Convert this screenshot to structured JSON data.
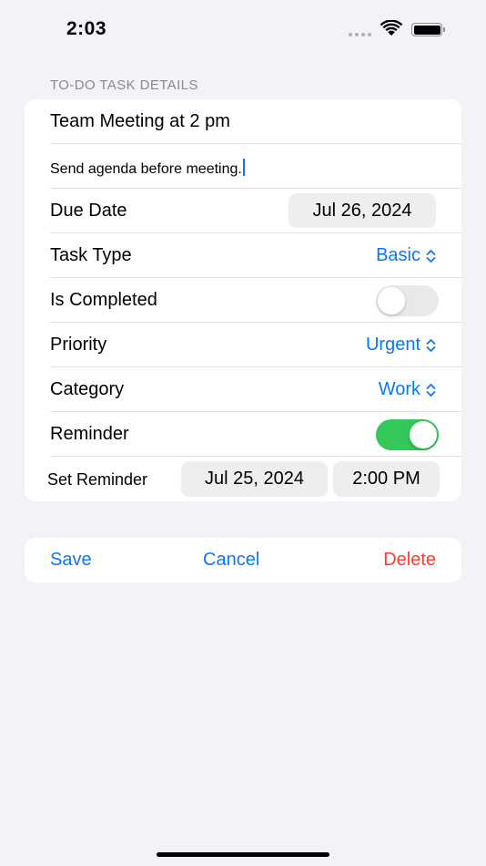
{
  "status_bar": {
    "time": "2:03"
  },
  "section_header": "TO-DO TASK DETAILS",
  "form": {
    "title_value": "Team Meeting at 2 pm",
    "notes_value": "Send agenda before meeting.",
    "due_date": {
      "label": "Due Date",
      "value": "Jul 26, 2024"
    },
    "task_type": {
      "label": "Task Type",
      "value": "Basic"
    },
    "is_completed": {
      "label": "Is Completed",
      "on": false
    },
    "priority": {
      "label": "Priority",
      "value": "Urgent"
    },
    "category": {
      "label": "Category",
      "value": "Work"
    },
    "reminder": {
      "label": "Reminder",
      "on": true
    },
    "set_reminder": {
      "label": "Set Reminder",
      "date": "Jul 25, 2024",
      "time": "2:00 PM"
    }
  },
  "actions": {
    "save": "Save",
    "cancel": "Cancel",
    "delete": "Delete"
  },
  "colors": {
    "accent": "#0a78f5",
    "destructive": "#ff3b30",
    "toggle_on": "#34c759",
    "background": "#f2f2f7"
  }
}
